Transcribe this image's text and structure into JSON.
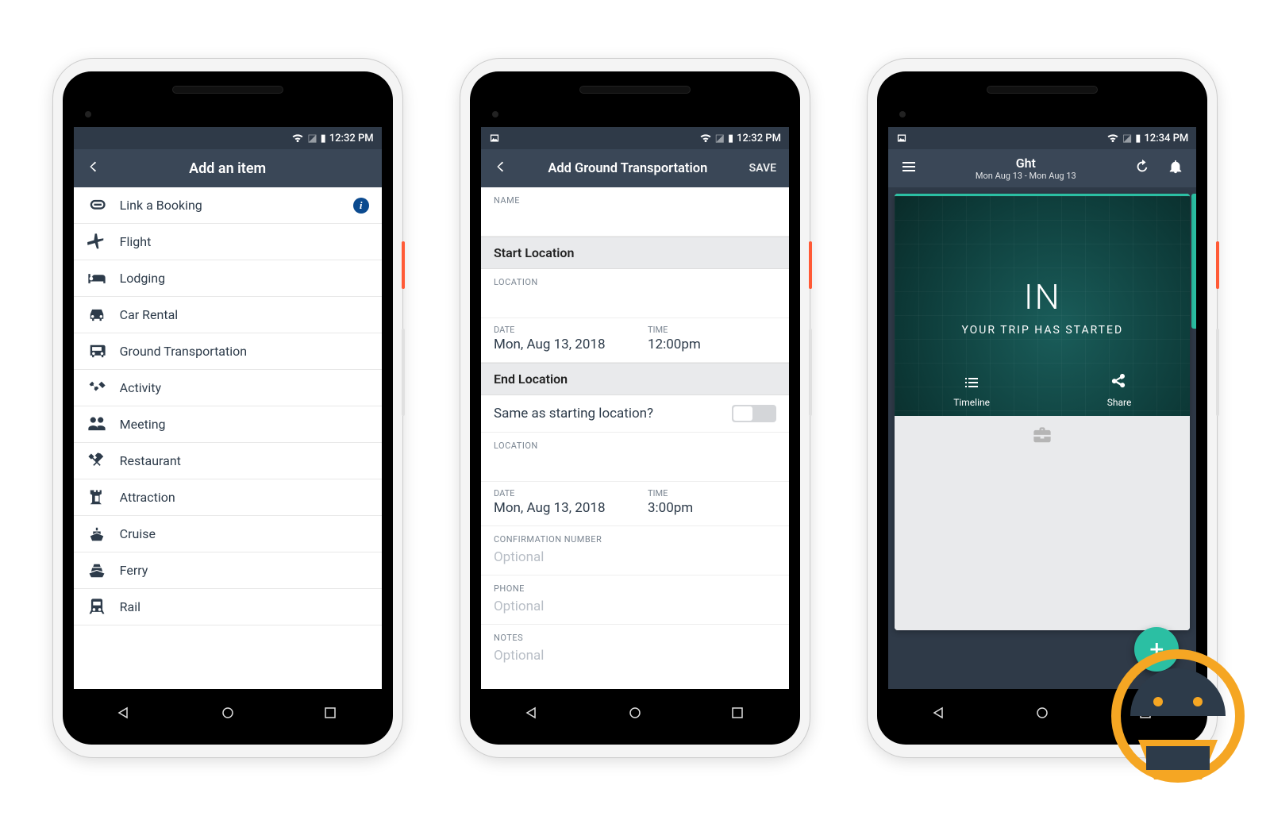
{
  "status": {
    "time_a": "12:32 PM",
    "time_b": "12:32 PM",
    "time_c": "12:34 PM"
  },
  "screen1": {
    "title": "Add an item",
    "items": [
      {
        "label": "Link a Booking",
        "icon": "link",
        "info": true
      },
      {
        "label": "Flight",
        "icon": "plane"
      },
      {
        "label": "Lodging",
        "icon": "bed"
      },
      {
        "label": "Car Rental",
        "icon": "car"
      },
      {
        "label": "Ground Transportation",
        "icon": "bus"
      },
      {
        "label": "Activity",
        "icon": "ticket"
      },
      {
        "label": "Meeting",
        "icon": "group"
      },
      {
        "label": "Restaurant",
        "icon": "fork"
      },
      {
        "label": "Attraction",
        "icon": "tower"
      },
      {
        "label": "Cruise",
        "icon": "ship"
      },
      {
        "label": "Ferry",
        "icon": "ferry"
      },
      {
        "label": "Rail",
        "icon": "rail"
      }
    ]
  },
  "screen2": {
    "title": "Add Ground Transportation",
    "save": "SAVE",
    "sections": {
      "name_label": "NAME",
      "start_header": "Start Location",
      "end_header": "End Location",
      "location_label": "LOCATION",
      "date_label": "DATE",
      "time_label": "TIME",
      "same_as": "Same as starting location?",
      "confirmation_label": "CONFIRMATION NUMBER",
      "phone_label": "PHONE",
      "notes_label": "NOTES",
      "optional": "Optional"
    },
    "start": {
      "date": "Mon, Aug 13, 2018",
      "time": "12:00pm"
    },
    "end": {
      "date": "Mon, Aug 13, 2018",
      "time": "3:00pm"
    }
  },
  "screen3": {
    "title": "Ght",
    "subtitle": "Mon Aug 13 - Mon Aug 13",
    "hero_big": "IN",
    "hero_sub": "YOUR TRIP HAS STARTED",
    "actions": {
      "timeline": "Timeline",
      "share": "Share"
    }
  }
}
